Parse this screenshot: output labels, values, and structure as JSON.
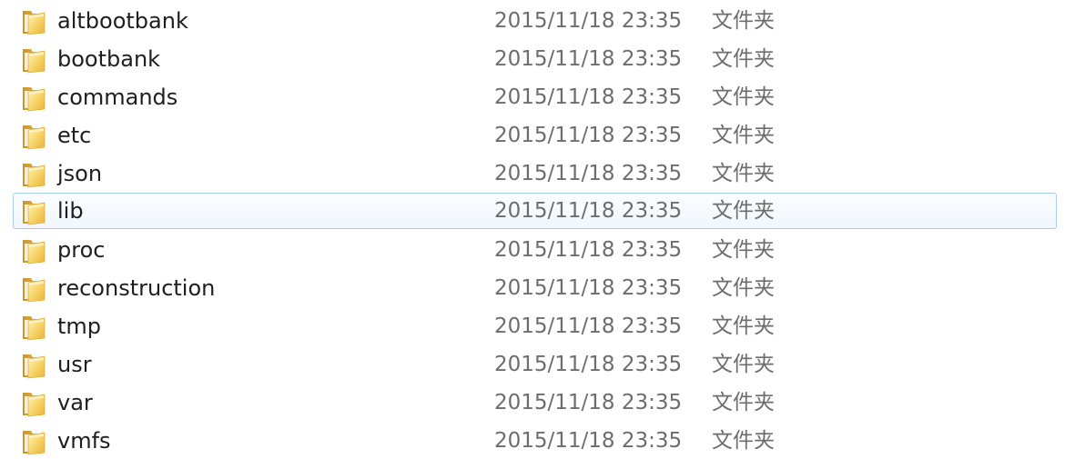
{
  "files": [
    {
      "name": "altbootbank",
      "date": "2015/11/18 23:35",
      "type": "文件夹",
      "icon": "folder-icon"
    },
    {
      "name": "bootbank",
      "date": "2015/11/18 23:35",
      "type": "文件夹",
      "icon": "folder-icon"
    },
    {
      "name": "commands",
      "date": "2015/11/18 23:35",
      "type": "文件夹",
      "icon": "folder-icon"
    },
    {
      "name": "etc",
      "date": "2015/11/18 23:35",
      "type": "文件夹",
      "icon": "folder-icon"
    },
    {
      "name": "json",
      "date": "2015/11/18 23:35",
      "type": "文件夹",
      "icon": "folder-icon"
    },
    {
      "name": "lib",
      "date": "2015/11/18 23:35",
      "type": "文件夹",
      "icon": "folder-icon",
      "hovered": true
    },
    {
      "name": "proc",
      "date": "2015/11/18 23:35",
      "type": "文件夹",
      "icon": "folder-icon"
    },
    {
      "name": "reconstruction",
      "date": "2015/11/18 23:35",
      "type": "文件夹",
      "icon": "folder-icon"
    },
    {
      "name": "tmp",
      "date": "2015/11/18 23:35",
      "type": "文件夹",
      "icon": "folder-icon"
    },
    {
      "name": "usr",
      "date": "2015/11/18 23:35",
      "type": "文件夹",
      "icon": "folder-icon"
    },
    {
      "name": "var",
      "date": "2015/11/18 23:35",
      "type": "文件夹",
      "icon": "folder-icon"
    },
    {
      "name": "vmfs",
      "date": "2015/11/18 23:35",
      "type": "文件夹",
      "icon": "folder-icon"
    }
  ],
  "colors": {
    "hover_border": "#a8cdf1",
    "hover_background": "#f1f7fe",
    "name_text": "#1e1e1e",
    "meta_text": "#6d6d6d",
    "folder_yellow": "#f2c94c"
  }
}
